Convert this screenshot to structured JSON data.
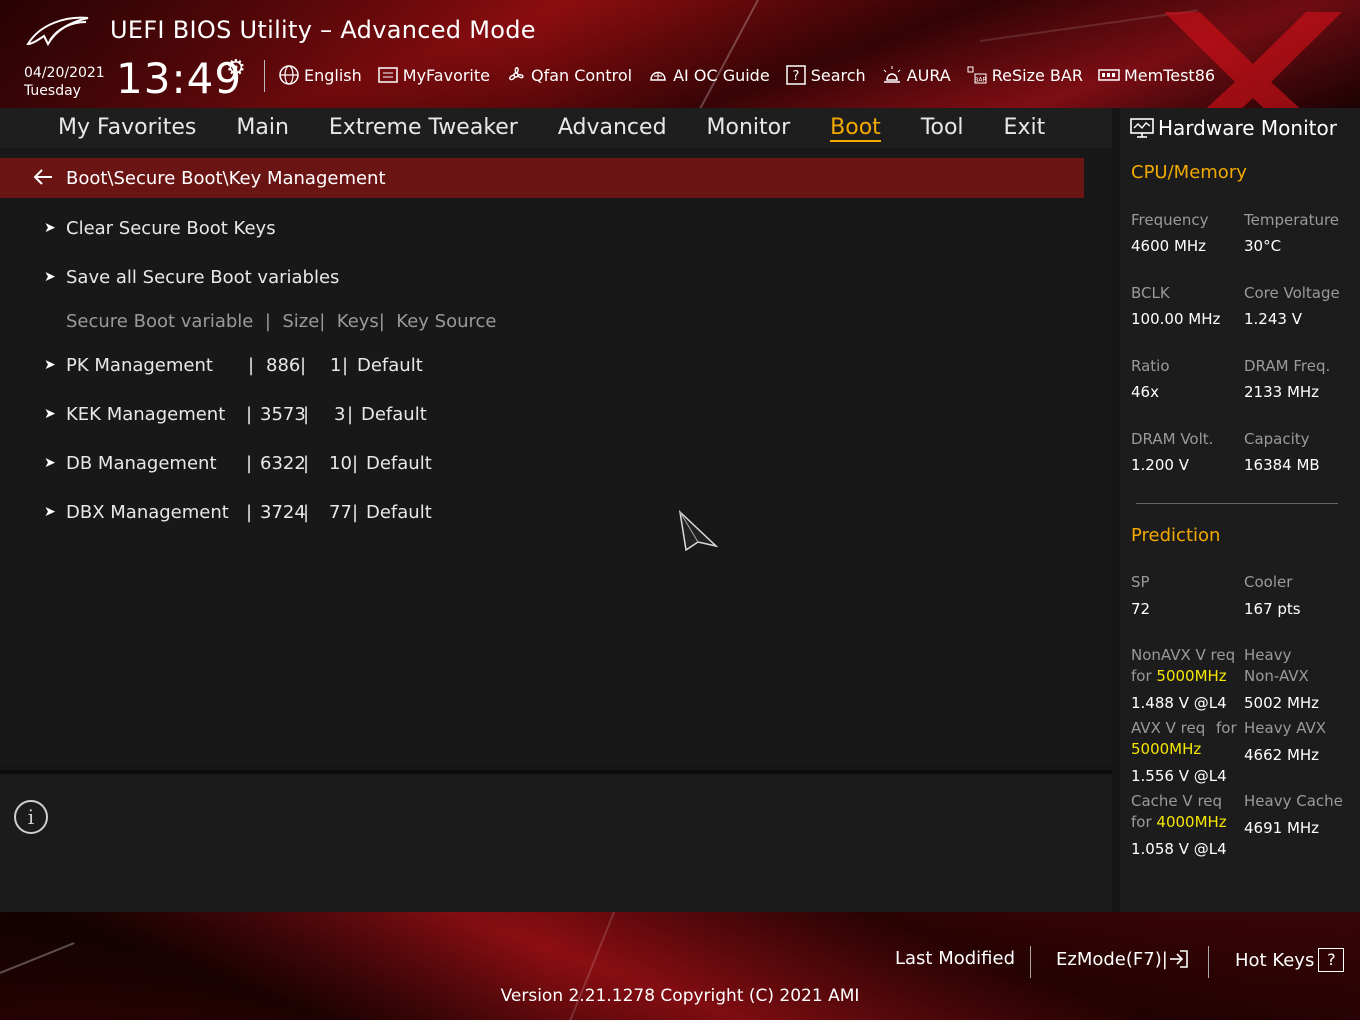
{
  "header": {
    "title": "UEFI BIOS Utility – Advanced Mode",
    "date": "04/20/2021",
    "weekday": "Tuesday",
    "time": "13:49",
    "toolbar": [
      {
        "label": "English",
        "icon": "globe-icon"
      },
      {
        "label": "MyFavorite",
        "icon": "favorite-list-icon"
      },
      {
        "label": "Qfan Control",
        "icon": "fan-icon"
      },
      {
        "label": "AI OC Guide",
        "icon": "ai-oc-icon"
      },
      {
        "label": "Search",
        "icon": "help-search-icon"
      },
      {
        "label": "AURA",
        "icon": "aura-light-icon"
      },
      {
        "label": "ReSize BAR",
        "icon": "resize-bar-icon"
      },
      {
        "label": "MemTest86",
        "icon": "memtest-icon"
      }
    ]
  },
  "nav": {
    "items": [
      "My Favorites",
      "Main",
      "Extreme Tweaker",
      "Advanced",
      "Monitor",
      "Boot",
      "Tool",
      "Exit"
    ],
    "active": "Boot"
  },
  "main": {
    "breadcrumb": "Boot\\Secure Boot\\Key Management",
    "actions": [
      "Clear Secure Boot Keys",
      "Save all Secure Boot variables"
    ],
    "table_header": "Secure Boot variable  |  Size|  Keys|  Key Source",
    "rows": [
      {
        "name": "PK Management",
        "size": "886",
        "keys": "1",
        "source": "Default"
      },
      {
        "name": "KEK Management",
        "size": "3573",
        "keys": "3",
        "source": "Default"
      },
      {
        "name": "DB Management",
        "size": "6322",
        "keys": "10",
        "source": "Default"
      },
      {
        "name": "DBX Management",
        "size": "3724",
        "keys": "77",
        "source": "Default"
      }
    ]
  },
  "hw": {
    "title": "Hardware Monitor",
    "cpu_section": "CPU/Memory",
    "frequency_label": "Frequency",
    "frequency": "4600 MHz",
    "temperature_label": "Temperature",
    "temperature": "30°C",
    "bclk_label": "BCLK",
    "bclk": "100.00 MHz",
    "core_voltage_label": "Core Voltage",
    "core_voltage": "1.243 V",
    "ratio_label": "Ratio",
    "ratio": "46x",
    "dram_freq_label": "DRAM Freq.",
    "dram_freq": "2133 MHz",
    "dram_volt_label": "DRAM Volt.",
    "dram_volt": "1.200 V",
    "capacity_label": "Capacity",
    "capacity": "16384 MB",
    "prediction_section": "Prediction",
    "sp_label": "SP",
    "sp": "72",
    "cooler_label": "Cooler",
    "cooler": "167 pts",
    "nonavx_label": "NonAVX V req",
    "nonavx_for": "for",
    "nonavx_freq": "5000MHz",
    "nonavx_v": "1.488 V @L4",
    "heavy_nonavx_label1": "Heavy",
    "heavy_nonavx_label2": "Non-AVX",
    "heavy_nonavx": "5002 MHz",
    "avx_label": "AVX V req",
    "avx_for": "for",
    "avx_freq": "5000MHz",
    "avx_v": "1.556 V @L4",
    "heavy_avx_label": "Heavy AVX",
    "heavy_avx": "4662 MHz",
    "cache_label": "Cache V req",
    "cache_for": "for",
    "cache_freq": "4000MHz",
    "cache_v": "1.058 V @L4",
    "heavy_cache_label": "Heavy Cache",
    "heavy_cache": "4691 MHz"
  },
  "footer": {
    "last_modified": "Last Modified",
    "ezmode": "EzMode(F7)|",
    "hotkeys": "Hot Keys",
    "hotkeys_key": "?",
    "version": "Version 2.21.1278 Copyright (C) 2021 AMI"
  },
  "colors": {
    "accent": "#f2a900",
    "highlight": "#f6e600",
    "breadcrumb_bg": "#6b1414",
    "brand_red": "#8c0d10"
  }
}
